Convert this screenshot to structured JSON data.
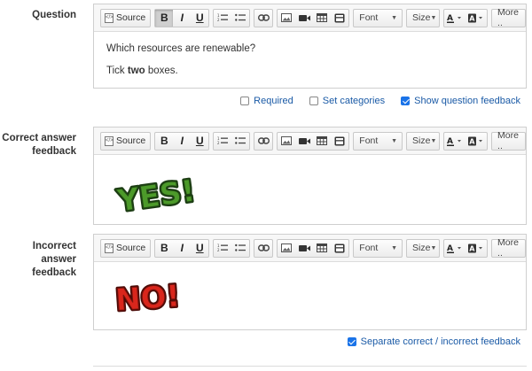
{
  "toolbar": {
    "source": "Source",
    "bold": "B",
    "italic": "I",
    "underline": "U",
    "font": "Font",
    "size": "Size",
    "more": "More .."
  },
  "question": {
    "label": "Question",
    "line1": "Which resources are renewable?",
    "line2_pre": "Tick ",
    "line2_bold": "two",
    "line2_post": " boxes."
  },
  "question_options": {
    "required": "Required",
    "set_categories": "Set categories",
    "show_feedback": "Show question feedback",
    "required_checked": false,
    "set_categories_checked": false,
    "show_feedback_checked": true
  },
  "correct": {
    "label_line1": "Correct answer",
    "label_line2": "feedback",
    "sticker": "YES!"
  },
  "incorrect": {
    "label_line1": "Incorrect answer",
    "label_line2": "feedback",
    "sticker": "NO!"
  },
  "separate": {
    "label": "Separate correct / incorrect feedback",
    "checked": true
  },
  "colors": {
    "link_blue": "#1a5aa6",
    "checkbox_blue": "#1a73e8",
    "yes_green": "#4c9a2a",
    "no_red": "#d9261c"
  }
}
